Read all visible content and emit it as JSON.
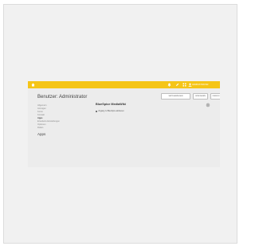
{
  "topbar": {
    "user_label": "ADMINISTRATOR",
    "icons": [
      "home-icon",
      "bell-icon",
      "pencil-icon",
      "grid-icon",
      "user-icon"
    ],
    "accent_color": "#f5c518"
  },
  "header": {
    "title": "Benutzer: Administrator",
    "buttons": {
      "show_page": "SEITE ANZEIGEN",
      "save": "SPEICHERN",
      "back": "ZURÜCK"
    }
  },
  "sidebar": {
    "items": [
      {
        "label": "Allgemein",
        "active": false
      },
      {
        "label": "Anzeigen",
        "active": false
      },
      {
        "label": "Konto",
        "active": false
      },
      {
        "label": "Kontakt",
        "active": false
      },
      {
        "label": "Apps",
        "active": true
      },
      {
        "label": "Erweiterte Einstellungen",
        "active": false
      },
      {
        "label": "Optionen",
        "active": false
      },
      {
        "label": "Rollen",
        "active": false
      }
    ],
    "section_heading": "Apps"
  },
  "main": {
    "section_title": "BlueSpice MediaWiki",
    "checkbox_label": "Zugang zu BlueSpice aktivieren",
    "checkbox_checked": false
  }
}
